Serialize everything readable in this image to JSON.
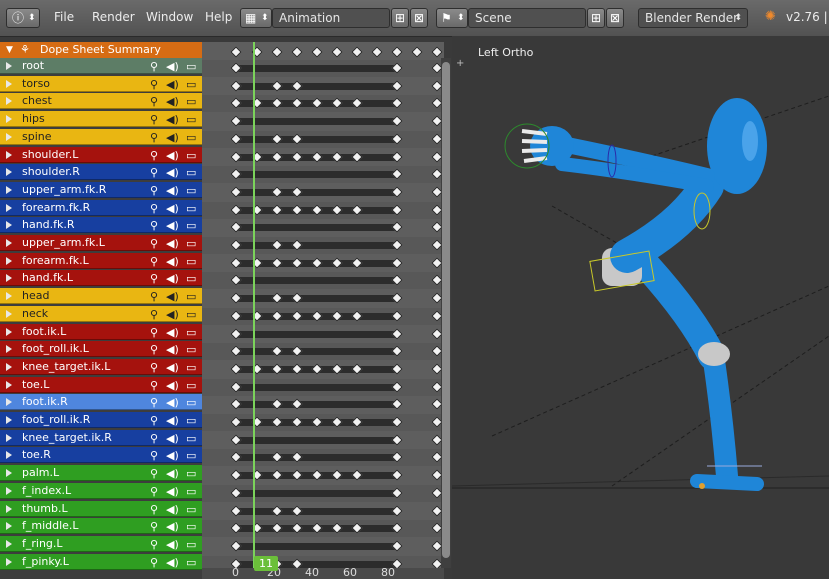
{
  "menubar": {
    "file": "File",
    "render": "Render",
    "window": "Window",
    "help": "Help",
    "screen": "Animation",
    "scene": "Scene",
    "engine": "Blender Render",
    "version": "v2.76 | "
  },
  "dopesheet": {
    "summary": "Dope Sheet Summary",
    "channels": [
      {
        "label": "root",
        "color": "#5d7d66"
      },
      {
        "label": "torso",
        "color": "#e9b612"
      },
      {
        "label": "chest",
        "color": "#e9b612"
      },
      {
        "label": "hips",
        "color": "#e9b612"
      },
      {
        "label": "spine",
        "color": "#e9b612"
      },
      {
        "label": "shoulder.L",
        "color": "#a5120d"
      },
      {
        "label": "shoulder.R",
        "color": "#173fa0"
      },
      {
        "label": "upper_arm.fk.R",
        "color": "#173fa0"
      },
      {
        "label": "forearm.fk.R",
        "color": "#173fa0"
      },
      {
        "label": "hand.fk.R",
        "color": "#173fa0"
      },
      {
        "label": "upper_arm.fk.L",
        "color": "#a5120d"
      },
      {
        "label": "forearm.fk.L",
        "color": "#a5120d"
      },
      {
        "label": "hand.fk.L",
        "color": "#a5120d"
      },
      {
        "label": "head",
        "color": "#e9b612"
      },
      {
        "label": "neck",
        "color": "#e9b612"
      },
      {
        "label": "foot.ik.L",
        "color": "#a5120d"
      },
      {
        "label": "foot_roll.ik.L",
        "color": "#a5120d"
      },
      {
        "label": "knee_target.ik.L",
        "color": "#a5120d"
      },
      {
        "label": "toe.L",
        "color": "#a5120d"
      },
      {
        "label": "foot.ik.R",
        "color": "#4f86de"
      },
      {
        "label": "foot_roll.ik.R",
        "color": "#173fa0"
      },
      {
        "label": "knee_target.ik.R",
        "color": "#173fa0"
      },
      {
        "label": "toe.R",
        "color": "#173fa0"
      },
      {
        "label": "palm.L",
        "color": "#2f9e21"
      },
      {
        "label": "f_index.L",
        "color": "#2f9e21"
      },
      {
        "label": "thumb.L",
        "color": "#2f9e21"
      },
      {
        "label": "f_middle.L",
        "color": "#2f9e21"
      },
      {
        "label": "f_ring.L",
        "color": "#2f9e21"
      },
      {
        "label": "f_pinky.L",
        "color": "#2f9e21"
      }
    ],
    "current_frame": "11",
    "ruler": [
      "0",
      "20",
      "40",
      "60",
      "80"
    ]
  },
  "viewport": {
    "title": "Left Ortho"
  }
}
